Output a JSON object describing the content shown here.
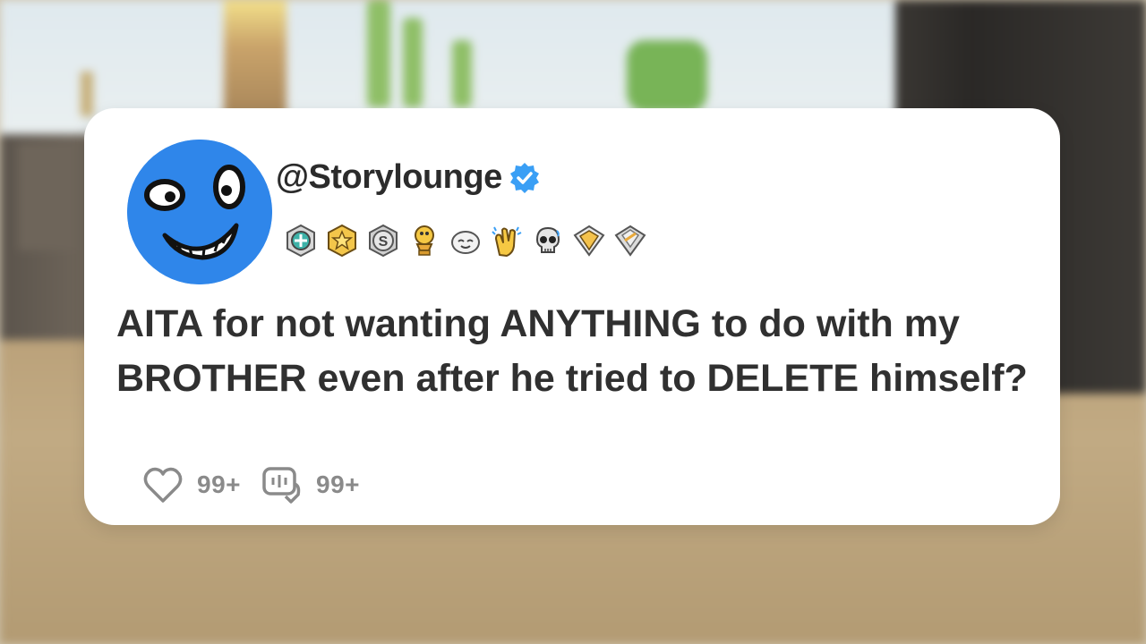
{
  "post": {
    "handle": "@Storylounge",
    "title": "AITA for not wanting ANYTHING to do with my BROTHER even after he tried to DELETE himself?",
    "likes_count": "99+",
    "comments_count": "99+"
  },
  "awards": [
    "helpful-award",
    "gold-star-award",
    "silver-coin-award",
    "gold-trophy-award",
    "wholesome-award",
    "clapping-hands-award",
    "skull-award",
    "diamond-award",
    "platinum-award"
  ],
  "colors": {
    "avatar": "#2f86ea",
    "verified": "#3a9ff5",
    "title_text": "#303030",
    "count_text": "#8a8a8a",
    "card": "#ffffff"
  }
}
